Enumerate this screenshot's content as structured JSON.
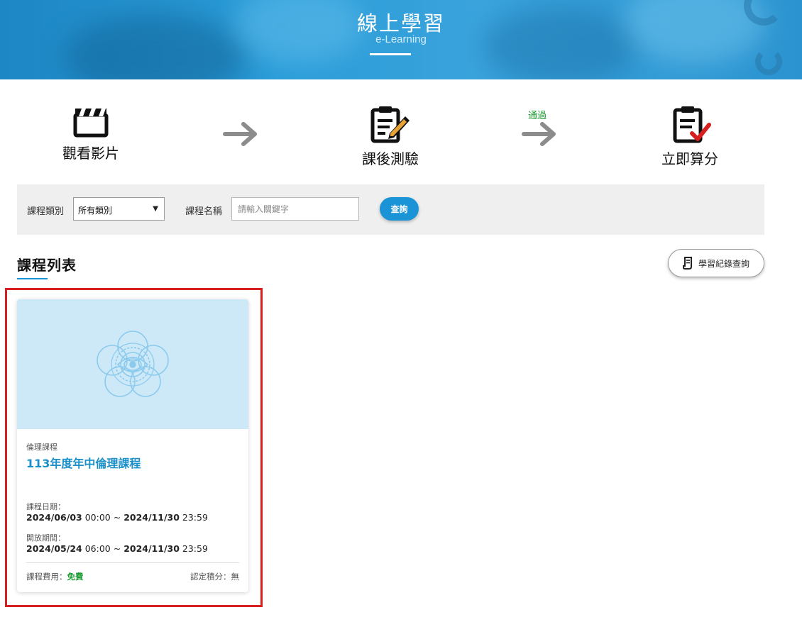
{
  "banner": {
    "title": "線上學習",
    "subtitle": "e-Learning"
  },
  "steps": [
    {
      "label": "觀看影片",
      "icon": "clapperboard-icon"
    },
    {
      "label": "課後測驗",
      "icon": "clipboard-pencil-icon"
    },
    {
      "label": "立即算分",
      "icon": "clipboard-check-icon"
    }
  ],
  "pass_label": "通過",
  "search": {
    "category_label": "課程類別",
    "category_value": "所有類別",
    "name_label": "課程名稱",
    "name_placeholder": "請輸入關鍵字",
    "button_label": "查詢"
  },
  "section": {
    "title": "課程列表",
    "record_button": "學習紀錄查詢"
  },
  "course": {
    "category": "倫理課程",
    "title": "113年度年中倫理課程",
    "date_label": "課程日期：",
    "date_start_day": "2024/06/03",
    "date_start_time": "00:00",
    "date_end_day": "2024/11/30",
    "date_end_time": "23:59",
    "open_label": "開放期間：",
    "open_start_day": "2024/05/24",
    "open_start_time": "06:00",
    "open_end_day": "2024/11/30",
    "open_end_time": "23:59",
    "tilde": "~",
    "fee_label": "課程費用：",
    "fee_value": "免費",
    "credit_label": "認定積分：",
    "credit_value": "無"
  },
  "colors": {
    "accent": "#1a94d6",
    "pass": "#1a9c32",
    "highlight": "#d61f1f",
    "check": "#d61f1f"
  }
}
